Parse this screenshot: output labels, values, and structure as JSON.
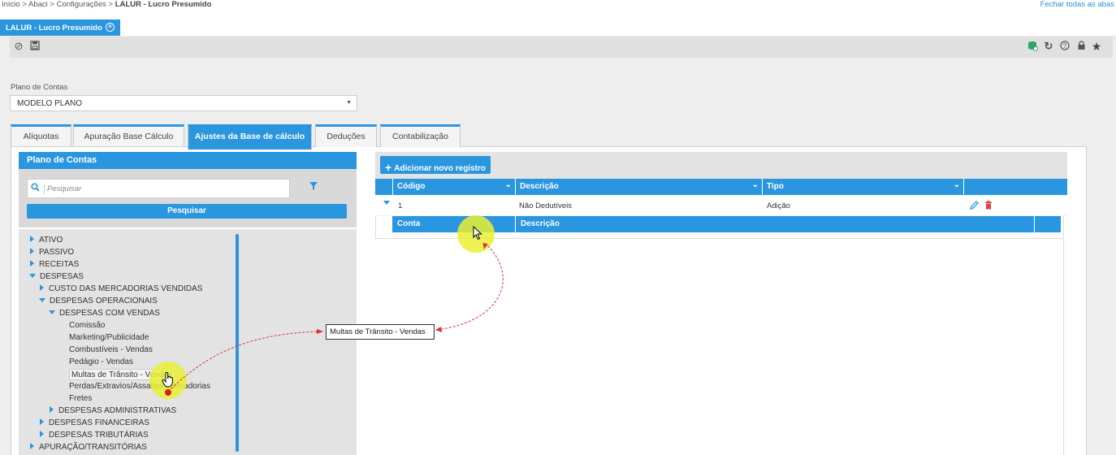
{
  "breadcrumb": {
    "path": "Início > Abaci > Configurações > ",
    "current": "LALUR - Lucro Presumido"
  },
  "close_all": "Fechar todas as abas",
  "main_tab": {
    "label": "LALUR - Lucro Presumido"
  },
  "plano": {
    "label": "Plano de Contas",
    "value": "MODELO PLANO"
  },
  "tabs": [
    {
      "label": "Alíquotas"
    },
    {
      "label": "Apuração Base Cálculo"
    },
    {
      "label": "Ajustes da Base de cálculo"
    },
    {
      "label": "Deduções"
    },
    {
      "label": "Contabilização"
    }
  ],
  "left": {
    "header": "Plano de Contas",
    "search_placeholder": "Pesquisar",
    "search_button": "Pesquisar",
    "tree": [
      {
        "label": "ATIVO",
        "state": "collapsed"
      },
      {
        "label": "PASSIVO",
        "state": "collapsed"
      },
      {
        "label": "RECEITAS",
        "state": "collapsed"
      },
      {
        "label": "DESPESAS",
        "state": "expanded"
      },
      {
        "label": "CUSTO DAS MERCADORIAS VENDIDAS",
        "state": "collapsed"
      },
      {
        "label": "DESPESAS OPERACIONAIS",
        "state": "expanded"
      },
      {
        "label": "DESPESAS COM VENDAS",
        "state": "expanded"
      },
      {
        "label": "Comissão",
        "state": "leaf"
      },
      {
        "label": "Marketing/Publicidade",
        "state": "leaf"
      },
      {
        "label": "Combustíveis - Vendas",
        "state": "leaf"
      },
      {
        "label": "Pedágio - Vendas",
        "state": "leaf"
      },
      {
        "label": "Multas de Trânsito - Vendas",
        "state": "leaf"
      },
      {
        "label": "Perdas/Extravios/Assaltos Mercadorias",
        "state": "leaf"
      },
      {
        "label": "Fretes",
        "state": "leaf"
      },
      {
        "label": "DESPESAS ADMINISTRATIVAS",
        "state": "collapsed"
      },
      {
        "label": "DESPESAS FINANCEIRAS",
        "state": "collapsed"
      },
      {
        "label": "DESPESAS TRIBUTÁRIAS",
        "state": "collapsed"
      },
      {
        "label": "APURAÇÃO/TRANSITÓRIAS",
        "state": "collapsed"
      }
    ]
  },
  "right": {
    "add_button": "Adicionar novo registro",
    "columns": [
      "Código",
      "Descrição",
      "Tipo"
    ],
    "row": {
      "codigo": "1",
      "descricao": "Não Dedutíveis",
      "tipo": "Adição"
    },
    "sub_columns": [
      "Conta",
      "Descrição"
    ]
  },
  "tooltip": "Multas de Trânsito - Vendas",
  "colors": {
    "accent": "#2a96df",
    "delete": "#e04040",
    "highlight": "#e8f032"
  }
}
